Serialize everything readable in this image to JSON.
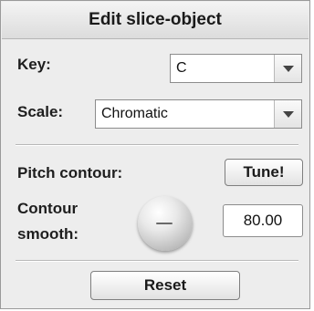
{
  "panel": {
    "title": "Edit slice-object"
  },
  "key": {
    "label": "Key:",
    "value": "C"
  },
  "scale": {
    "label": "Scale:",
    "value": "Chromatic"
  },
  "pitch_contour": {
    "label": "Pitch contour:",
    "button_label": "Tune!"
  },
  "contour_smooth": {
    "label_line1": "Contour",
    "label_line2": "smooth:",
    "value": "80.00"
  },
  "reset": {
    "button_label": "Reset"
  },
  "icons": {
    "dropdown": "chevron-down-icon",
    "knob": "rotary-knob"
  }
}
